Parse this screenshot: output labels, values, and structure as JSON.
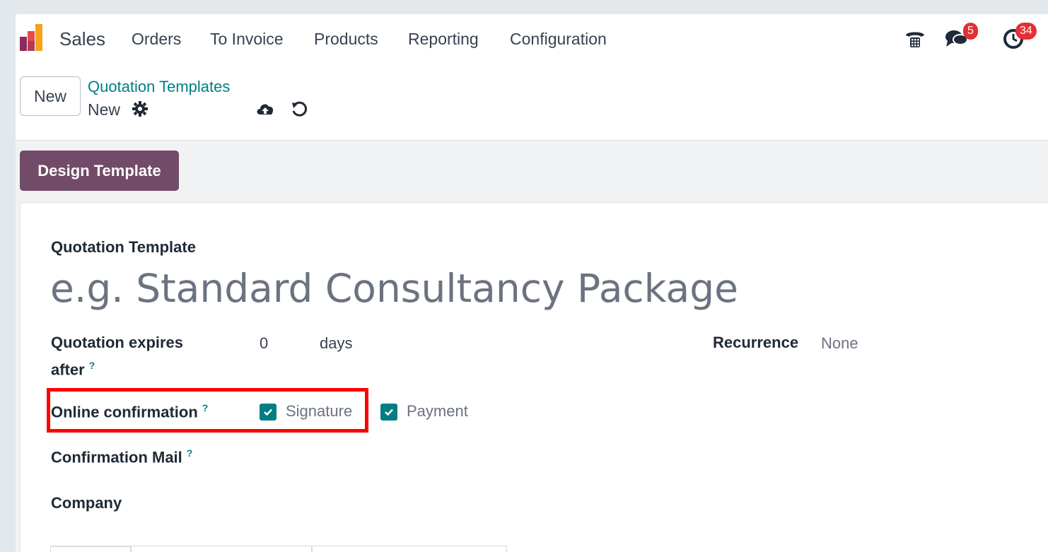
{
  "navbar": {
    "app_name": "Sales",
    "menu": [
      "Orders",
      "To Invoice",
      "Products",
      "Reporting",
      "Configuration"
    ],
    "messages_count": "5",
    "activities_count": "34"
  },
  "control_panel": {
    "new_button": "New",
    "breadcrumb": "Quotation Templates",
    "record_name": "New"
  },
  "status_bar": {
    "design_button": "Design Template"
  },
  "form": {
    "name_label": "Quotation Template",
    "name_placeholder": "e.g. Standard Consultancy Package",
    "expires_label_line1": "Quotation expires",
    "expires_label_line2": "after",
    "help_mark": "?",
    "expires_value": "0",
    "expires_unit": "days",
    "recurrence_label": "Recurrence",
    "recurrence_value": "None",
    "online_confirmation_label": "Online confirmation",
    "signature_label": "Signature",
    "signature_checked": true,
    "payment_label": "Payment",
    "payment_checked": true,
    "confirmation_mail_label": "Confirmation Mail",
    "company_label": "Company"
  },
  "colors": {
    "brand": "#714b67",
    "accent": "#017e84",
    "badge": "#e52e35",
    "highlight": "#ff0000"
  },
  "icons": [
    "app-logo-icon",
    "phone-icon",
    "chat-icon",
    "clock-icon",
    "gear-icon",
    "cloud-upload-icon",
    "undo-icon",
    "check-icon"
  ]
}
